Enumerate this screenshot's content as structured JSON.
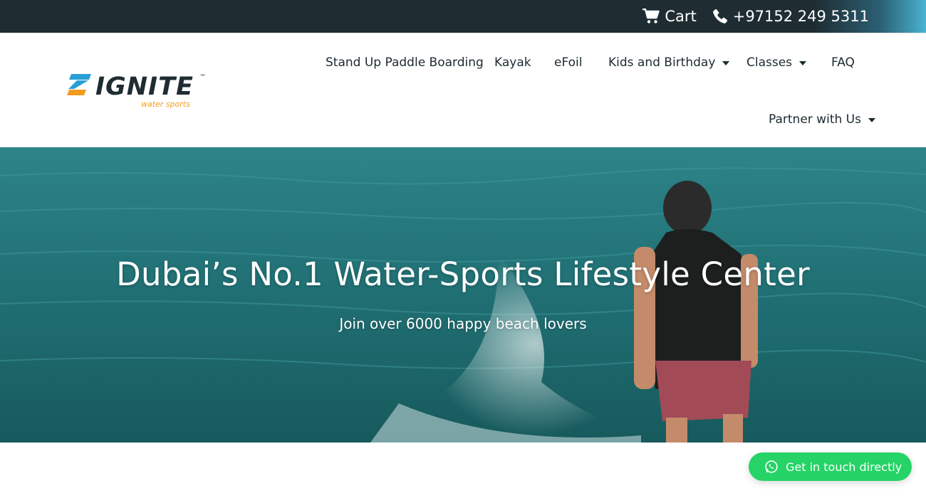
{
  "topbar": {
    "cart_label": "Cart",
    "phone_label": "+97152 249 5311",
    "cart_icon": "cart-icon",
    "phone_icon": "phone-icon"
  },
  "logo": {
    "brand": "IGNITE",
    "trademark": "™",
    "tagline": "water sports",
    "colors": {
      "blue": "#2a9fd6",
      "orange": "#f39c1f",
      "dark": "#1f2d33"
    }
  },
  "nav": {
    "items": [
      {
        "label": "Stand Up Paddle Boarding",
        "has_dropdown": false
      },
      {
        "label": "Kayak",
        "has_dropdown": false
      },
      {
        "label": "eFoil",
        "has_dropdown": false
      },
      {
        "label": "Kids and Birthday",
        "has_dropdown": true
      },
      {
        "label": "Classes",
        "has_dropdown": true
      },
      {
        "label": "FAQ",
        "has_dropdown": false
      },
      {
        "label": "Partner with Us",
        "has_dropdown": true
      }
    ]
  },
  "hero": {
    "title": "Dubai’s No.1 Water-Sports Lifestyle Center",
    "subtitle": "Join over 6000 happy beach lovers"
  },
  "cta": {
    "label": "Get in touch directly",
    "icon": "whatsapp-icon",
    "color": "#25d366"
  }
}
